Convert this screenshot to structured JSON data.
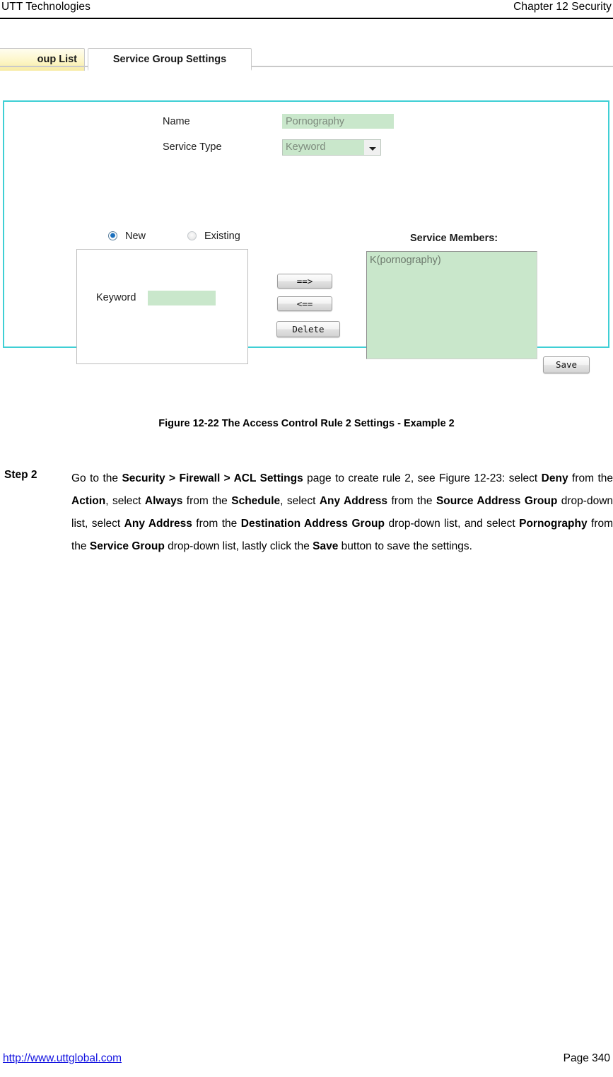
{
  "header": {
    "left": "UTT Technologies",
    "right": "Chapter 12 Security"
  },
  "screenshot": {
    "tabs": [
      {
        "label": "oup List",
        "full_label": "Service Group List",
        "active": false
      },
      {
        "label": "Service Group Settings",
        "active": true
      }
    ],
    "form": {
      "name_label": "Name",
      "name_value": "Pornography",
      "service_type_label": "Service Type",
      "service_type_value": "Keyword",
      "radio_new_label": "New",
      "radio_existing_label": "Existing",
      "radio_selected": "New",
      "keyword_label": "Keyword",
      "keyword_value": "",
      "buttons": {
        "add": "==>",
        "remove": "<==",
        "delete": "Delete",
        "save": "Save"
      },
      "members_label": "Service Members:",
      "members": [
        "K(pornography)"
      ]
    },
    "colors": {
      "panel_border": "#3fcfd5",
      "input_fill": "#c9e7cb",
      "tab_active_bg": "#ffffff",
      "tab_inactive_bg": "#f7eba3",
      "radio_selected": "#1a6fbd"
    }
  },
  "figure": {
    "caption": "Figure 12-22 The Access Control Rule 2 Settings - Example 2"
  },
  "step": {
    "label": "Step 2",
    "segments": [
      {
        "text": "Go to the ",
        "bold": false
      },
      {
        "text": "Security > Firewall > ACL Settings",
        "bold": true
      },
      {
        "text": " page to create rule 2, see Figure 12-23: select ",
        "bold": false
      },
      {
        "text": "Deny",
        "bold": true
      },
      {
        "text": " from the ",
        "bold": false
      },
      {
        "text": "Action",
        "bold": true
      },
      {
        "text": ", select ",
        "bold": false
      },
      {
        "text": "Always",
        "bold": true
      },
      {
        "text": " from the ",
        "bold": false
      },
      {
        "text": "Schedule",
        "bold": true
      },
      {
        "text": ", select ",
        "bold": false
      },
      {
        "text": "Any Address",
        "bold": true
      },
      {
        "text": " from the ",
        "bold": false
      },
      {
        "text": "Source Address Group",
        "bold": true
      },
      {
        "text": " drop-down list, select ",
        "bold": false
      },
      {
        "text": "Any Address",
        "bold": true
      },
      {
        "text": " from the ",
        "bold": false
      },
      {
        "text": "Destination Address Group",
        "bold": true
      },
      {
        "text": " drop-down list, and select ",
        "bold": false
      },
      {
        "text": "Pornography",
        "bold": true
      },
      {
        "text": " from the ",
        "bold": false
      },
      {
        "text": "Service Group",
        "bold": true
      },
      {
        "text": " drop-down list, lastly click the ",
        "bold": false
      },
      {
        "text": "Save",
        "bold": true
      },
      {
        "text": " button to save the settings.",
        "bold": false
      }
    ]
  },
  "footer": {
    "url": "http://www.uttglobal.com",
    "page": "Page 340"
  }
}
